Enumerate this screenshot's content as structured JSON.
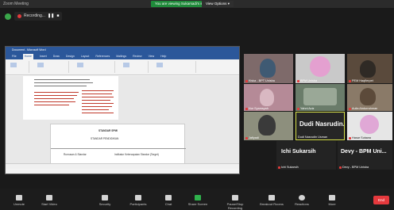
{
  "window": {
    "title": "Zoom Meeting"
  },
  "banner": {
    "share_text": "You are viewing Sukarsadi's screen",
    "view_options": "View Options"
  },
  "recording": {
    "label": "Recording..."
  },
  "document": {
    "title": "Document - Microsoft Word",
    "tabs": [
      "File",
      "Home",
      "Insert",
      "Draw",
      "Design",
      "Layout",
      "References",
      "Mailings",
      "Review",
      "View",
      "Help"
    ],
    "table_title": "STANDAR SPMI",
    "table_subtitle": "STANDAR PENDIDIKAN",
    "col_header_1": "Rumusan & Standar",
    "col_header_2": "Indikator Ketercapaian Standar (Target)"
  },
  "participants": [
    {
      "name": "Kiska - BPT Unisba",
      "muted": true
    },
    {
      "name": "BPM Unisba",
      "muted": true
    },
    {
      "name": "PEM Haqfierpet",
      "muted": true
    },
    {
      "name": "Nur Syamsyah",
      "muted": true
    },
    {
      "name": "Yahni Aziz",
      "muted": true
    },
    {
      "name": "Aulia Abdurrahman",
      "muted": true
    },
    {
      "name": "Jafiyadi",
      "muted": true
    },
    {
      "name": "Dudi Nasrudin Usman",
      "muted": false,
      "big_label": "Dudi  Nasrudin..."
    },
    {
      "name": "Hasar Sutawa",
      "muted": true
    },
    {
      "name": "Ichi Sukarsih",
      "muted": true,
      "big_label": "Ichi Sukarsih"
    },
    {
      "name": "Devy - BPM Unisba",
      "muted": true,
      "big_label": "Devy - BPM Uni..."
    }
  ],
  "toolbar": {
    "unmute": "Unmute",
    "start_video": "Start Video",
    "security": "Security",
    "participants": "Participants",
    "participants_count": "15",
    "chat": "Chat",
    "share_screen": "Share Screen",
    "pause_recording": "Pause/Stop Recording",
    "breakout_rooms": "Breakout Rooms",
    "reactions": "Reactions",
    "more": "More",
    "end": "End"
  }
}
